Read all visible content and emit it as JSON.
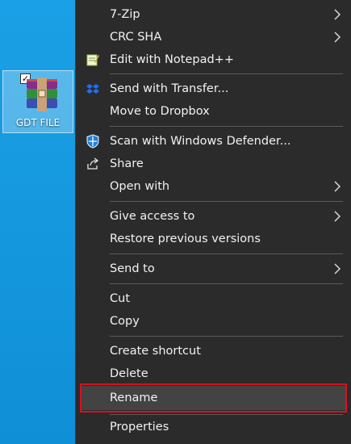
{
  "desktop": {
    "icon_label": "GDT FILE",
    "icon_name": "winrar-archive-icon",
    "checked": true
  },
  "menu": {
    "items": [
      {
        "label": "7-Zip",
        "submenu": true
      },
      {
        "label": "CRC SHA",
        "submenu": true
      },
      {
        "label": "Edit with Notepad++",
        "icon": "notepad-plus-plus-icon"
      },
      {
        "label": "Send with Transfer...",
        "icon": "dropbox-icon"
      },
      {
        "label": "Move to Dropbox"
      },
      {
        "label": "Scan with Windows Defender...",
        "icon": "windows-defender-icon"
      },
      {
        "label": "Share",
        "icon": "share-icon"
      },
      {
        "label": "Open with",
        "submenu": true
      },
      {
        "label": "Give access to",
        "submenu": true
      },
      {
        "label": "Restore previous versions"
      },
      {
        "label": "Send to",
        "submenu": true
      },
      {
        "label": "Cut"
      },
      {
        "label": "Copy"
      },
      {
        "label": "Create shortcut"
      },
      {
        "label": "Delete"
      },
      {
        "label": "Rename",
        "highlighted": true
      },
      {
        "label": "Properties"
      }
    ]
  },
  "colors": {
    "desktop": "#1597dd",
    "menu_bg": "#2b2b2b",
    "menu_text": "#f2f2f2",
    "highlight_border": "#d9101c"
  }
}
